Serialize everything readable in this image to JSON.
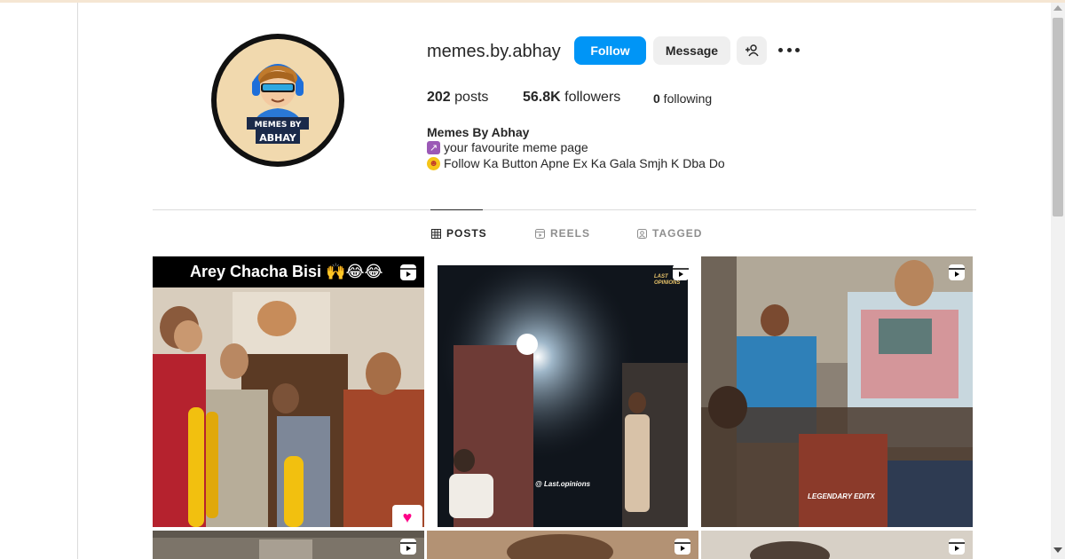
{
  "profile": {
    "username": "memes.by.abhay",
    "avatar_text_top": "MEMES BY",
    "avatar_text_bottom": "ABHAY",
    "follow_label": "Follow",
    "message_label": "Message",
    "add_user_icon": "add-user-icon",
    "more_icon": "more-options-icon"
  },
  "stats": {
    "posts_count": "202",
    "posts_label": " posts",
    "followers_count": "56.8K",
    "followers_label": " followers",
    "following_count": "0",
    "following_label": " following"
  },
  "bio": {
    "name": "Memes By Abhay",
    "line1": "your favourite meme page",
    "line2": "Follow Ka Button Apne Ex Ka Gala Smjh K Dba Do"
  },
  "tabs": [
    {
      "label": "POSTS",
      "icon": "grid-icon",
      "active": true
    },
    {
      "label": "REELS",
      "icon": "reels-icon",
      "active": false
    },
    {
      "label": "TAGGED",
      "icon": "tagged-icon",
      "active": false
    }
  ],
  "posts": [
    {
      "caption": "Arey Chacha Bisi 🙌😂😂",
      "type": "reel",
      "badge": "♥"
    },
    {
      "watermark": "@ Last.opinions",
      "corner_mark": "LAST OPINIONS",
      "type": "reel"
    },
    {
      "watermark": "LEGENDARY EDITX",
      "type": "reel"
    },
    {
      "type": "reel"
    },
    {
      "type": "reel"
    },
    {
      "type": "reel"
    }
  ],
  "colors": {
    "follow_button": "#0095f6",
    "secondary_button": "#efefef",
    "text": "#262626",
    "muted": "#8e8e8e",
    "divider": "#dbdbdb"
  }
}
